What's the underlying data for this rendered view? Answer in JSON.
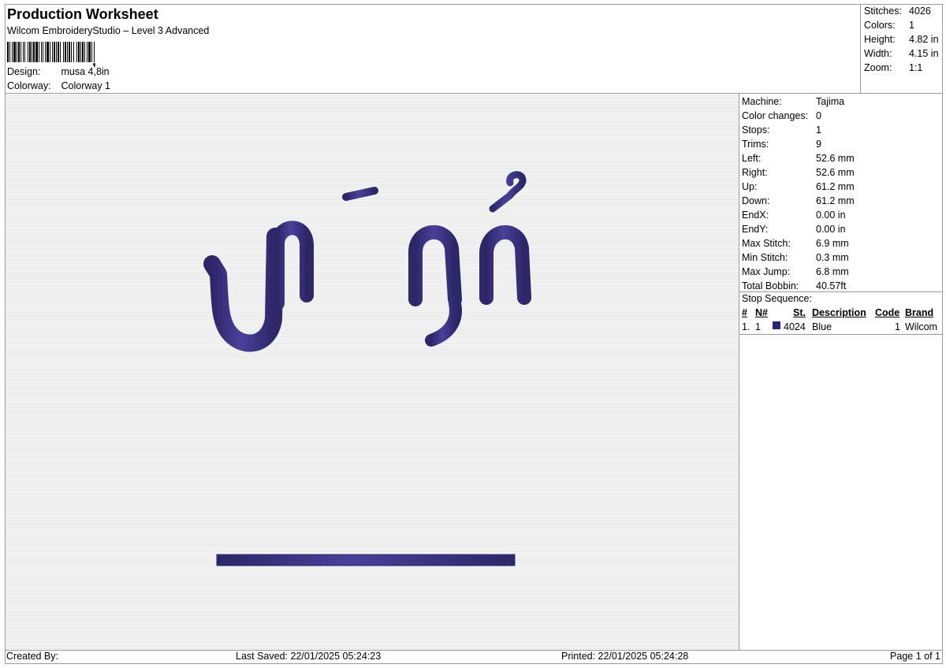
{
  "header": {
    "title": "Production Worksheet",
    "subtitle": "Wilcom EmbroideryStudio – Level 3 Advanced",
    "design_label": "Design:",
    "design_value": "musa 4,8in",
    "colorway_label": "Colorway:",
    "colorway_value": "Colorway 1"
  },
  "summary": {
    "stitches_label": "Stitches:",
    "stitches": "4026",
    "colors_label": "Colors:",
    "colors": "1",
    "height_label": "Height:",
    "height": "4.82 in",
    "width_label": "Width:",
    "width": "4.15 in",
    "zoom_label": "Zoom:",
    "zoom": "1:1"
  },
  "machine_info": [
    {
      "label": "Machine:",
      "value": "Tajima"
    },
    {
      "label": "Color changes:",
      "value": "0"
    },
    {
      "label": "Stops:",
      "value": "1"
    },
    {
      "label": "Trims:",
      "value": "9"
    },
    {
      "label": "Left:",
      "value": "52.6 mm"
    },
    {
      "label": "Right:",
      "value": "52.6 mm"
    },
    {
      "label": "Up:",
      "value": "61.2 mm"
    },
    {
      "label": "Down:",
      "value": "61.2 mm"
    },
    {
      "label": "EndX:",
      "value": "0.00 in"
    },
    {
      "label": "EndY:",
      "value": "0.00 in"
    },
    {
      "label": "Max Stitch:",
      "value": "6.9 mm"
    },
    {
      "label": "Min Stitch:",
      "value": "0.3 mm"
    },
    {
      "label": "Max Jump:",
      "value": "6.8 mm"
    },
    {
      "label": "Total Bobbin:",
      "value": "40.57ft"
    }
  ],
  "stop_sequence": {
    "label": "Stop Sequence:",
    "columns": {
      "num": "#",
      "needle": "N#",
      "stitches": "St.",
      "description": "Description",
      "code": "Code",
      "brand": "Brand"
    },
    "rows": [
      {
        "num": "1.",
        "needle": "1",
        "stitches": "4024",
        "description": "Blue",
        "code": "1",
        "brand": "Wilcom",
        "color": "#2a2472"
      }
    ]
  },
  "design": {
    "thread_color": "#3e3579",
    "thread_highlight": "#6a5fb0"
  },
  "footer": {
    "created_by": "Created By:",
    "last_saved": "Last Saved: 22/01/2025 05:24:23",
    "printed": "Printed: 22/01/2025 05:24:28",
    "page": "Page 1 of 1"
  }
}
